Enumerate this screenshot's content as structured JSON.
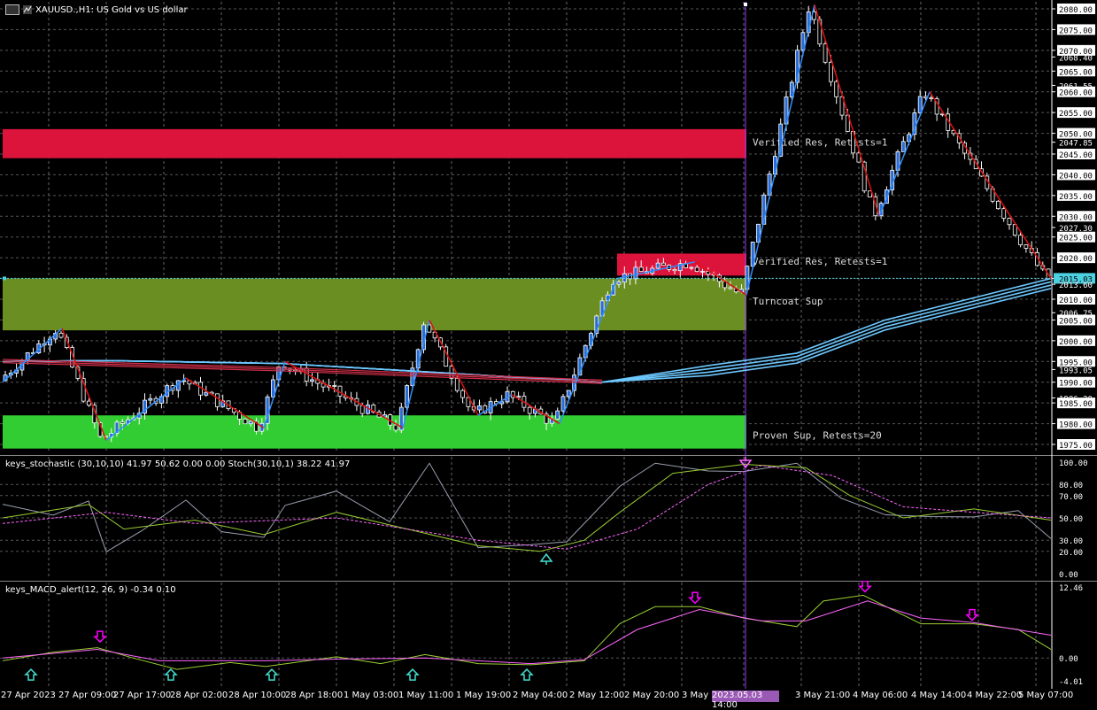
{
  "window": {
    "symbol_title": "XAUUSD.,H1: US Gold vs US dollar"
  },
  "colors": {
    "background": "#000000",
    "bull_candle": "#2a6bd6",
    "bear_candle": "#ffffff",
    "zigzag_up": "#2f8fff",
    "zigzag_down": "#e01010",
    "resistance_zone": "#dc143c",
    "support_zone": "#32cd32",
    "turncoat_zone": "#6b8e23",
    "vline": "#9933ff",
    "bid_line": "#4dd0e1"
  },
  "price_axis": {
    "labels": [
      "2080.00",
      "2075.00",
      "2070.00",
      "2068.40",
      "2065.00",
      "2061.55",
      "2060.00",
      "2055.00",
      "2050.00",
      "2047.85",
      "2045.00",
      "2040.00",
      "2035.00",
      "2030.00",
      "2027.30",
      "2025.00",
      "2020.00",
      "2015.03",
      "2013.60",
      "2010.00",
      "2006.75",
      "2005.00",
      "2000.00",
      "1995.00",
      "1993.05",
      "1990.00",
      "1986.20",
      "1985.00",
      "1980.00",
      "1975.00"
    ],
    "current_price": "2015.03"
  },
  "zones": [
    {
      "label": "Verified Res, Retests=1",
      "type": "resistance"
    },
    {
      "label": "Verified Res, Retests=1",
      "type": "resistance"
    },
    {
      "label": "Turncoat Sup",
      "type": "turncoat"
    },
    {
      "label": "Proven Sup, Retests=20",
      "type": "support"
    }
  ],
  "stochastic": {
    "title": "keys_stochastic (30,10,10) 41.97 50.62 0.00 0.00 Stoch(30,10,1) 38.22 41.97",
    "axis": [
      "100.00",
      "80.00",
      "70.00",
      "50.00",
      "30.00",
      "20.00",
      "0.00"
    ]
  },
  "macd": {
    "title": "keys_MACD_alert(12, 26, 9) -0.34 0.10",
    "axis": [
      "12.46",
      "0.00",
      "-4.01"
    ]
  },
  "time_axis": {
    "labels": [
      "27 Apr 2023",
      "27 Apr 09:00",
      "27 Apr 17:00",
      "28 Apr 02:00",
      "28 Apr 10:00",
      "28 Apr 18:00",
      "1 May 03:00",
      "1 May 11:00",
      "1 May 19:00",
      "2 May 04:00",
      "2 May 12:00",
      "2 May 20:00",
      "3 May",
      "3 May 21:00",
      "4 May 06:00",
      "4 May 14:00",
      "4 May 22:00",
      "5 May 07:00"
    ],
    "highlight": "2023.05.03 14:00"
  }
}
